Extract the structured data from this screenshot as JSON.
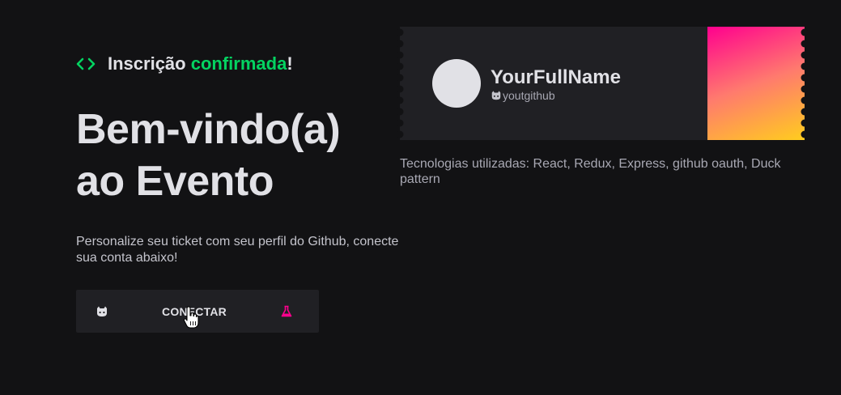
{
  "status": {
    "prefix": "Inscrição",
    "highlight": "confirmada",
    "suffix": "!",
    "icon": "code-icon"
  },
  "headline": {
    "line1": "Bem-vindo(a)",
    "line2": "ao Evento"
  },
  "description": "Personalize seu ticket com seu perfil do Github, conecte sua conta abaixo!",
  "connect_button": {
    "label": "CONECTAR",
    "left_icon": "github-icon",
    "right_icon": "flask-icon"
  },
  "ticket": {
    "full_name": "YourFullName",
    "username": "youtgithub",
    "username_icon": "github-icon"
  },
  "technologies": "Tecnologias utilizadas: React, Redux, Express, github oauth, Duck pattern",
  "colors": {
    "background": "#121214",
    "accent": "#04d361",
    "surface": "#202024",
    "pink": "#ff008e",
    "yellow": "#ffcd1e"
  }
}
